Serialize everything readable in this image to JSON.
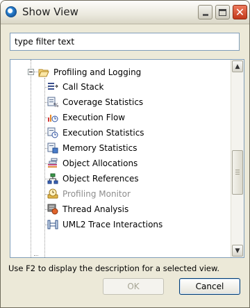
{
  "window": {
    "title": "Show View",
    "controls": {
      "minimize": "_",
      "maximize": "□",
      "close": "✕"
    }
  },
  "filter": {
    "value": "type filter text"
  },
  "tree": {
    "category": "Profiling and Logging",
    "expanded": true,
    "items": [
      {
        "label": "Call Stack",
        "icon": "call-stack-icon",
        "enabled": true
      },
      {
        "label": "Coverage Statistics",
        "icon": "coverage-statistics-icon",
        "enabled": true
      },
      {
        "label": "Execution Flow",
        "icon": "execution-flow-icon",
        "enabled": true
      },
      {
        "label": "Execution Statistics",
        "icon": "execution-statistics-icon",
        "enabled": true
      },
      {
        "label": "Memory Statistics",
        "icon": "memory-statistics-icon",
        "enabled": true
      },
      {
        "label": "Object Allocations",
        "icon": "object-allocations-icon",
        "enabled": true
      },
      {
        "label": "Object References",
        "icon": "object-references-icon",
        "enabled": true
      },
      {
        "label": "Profiling Monitor",
        "icon": "profiling-monitor-icon",
        "enabled": false
      },
      {
        "label": "Thread Analysis",
        "icon": "thread-analysis-icon",
        "enabled": true
      },
      {
        "label": "UML2 Trace Interactions",
        "icon": "uml2-trace-interactions-icon",
        "enabled": true
      }
    ]
  },
  "description": "Use F2 to display the description for a selected view.",
  "buttons": {
    "ok": "OK",
    "cancel": "Cancel",
    "ok_enabled": false
  },
  "colors": {
    "accent": "#7f9db9",
    "disabled_text": "#8d8d8d",
    "close_red": "#c2391b"
  }
}
